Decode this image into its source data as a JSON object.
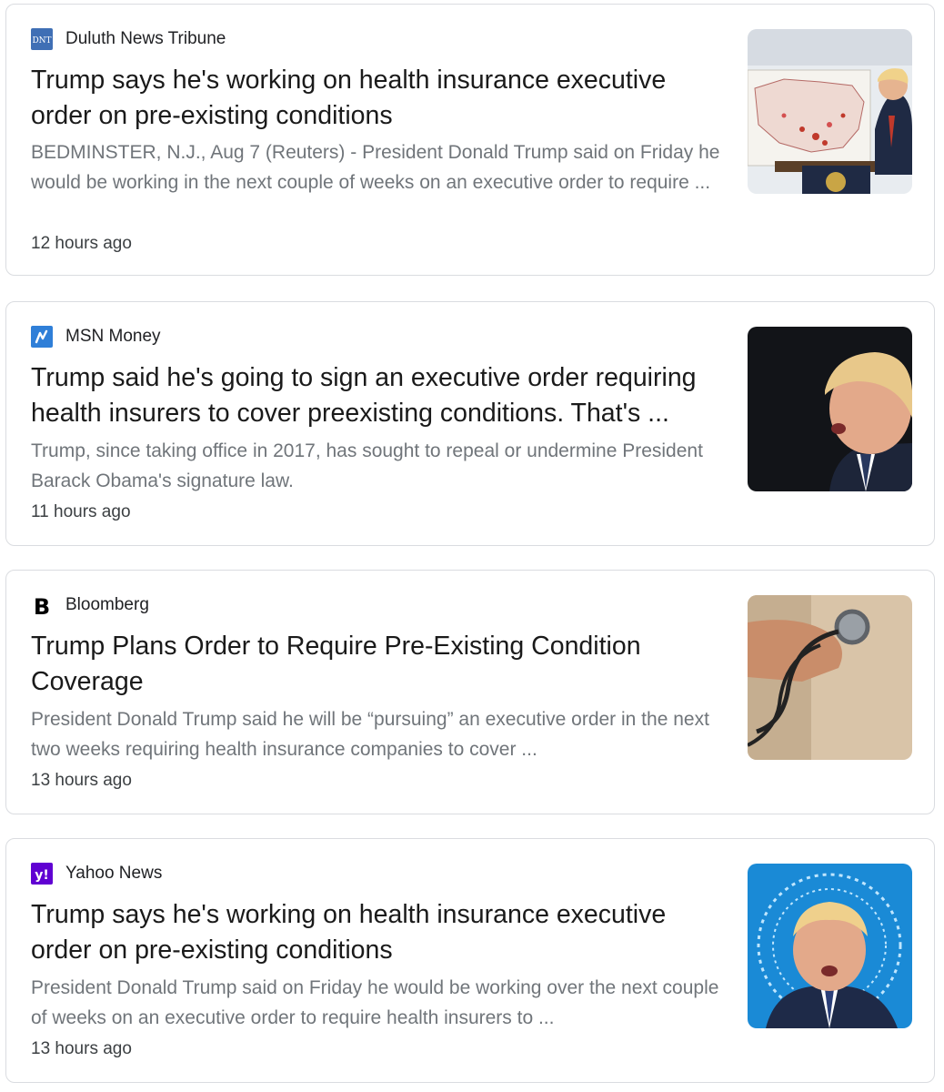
{
  "results": [
    {
      "source": "Duluth News Tribune",
      "favicon_text": "DNT",
      "headline": "Trump says he's working on health insurance executive order on pre-existing conditions",
      "snippet": "BEDMINSTER, N.J., Aug 7 (Reuters) - President Donald Trump said on Friday he would be working in the next couple of weeks on an executive order to require ...",
      "time": "12 hours ago"
    },
    {
      "source": "MSN Money",
      "headline": "Trump said he's going to sign an executive order requiring health insurers to cover preexisting conditions. That's ...",
      "snippet": "Trump, since taking office in 2017, has sought to repeal or undermine President Barack Obama's signature law.",
      "time": "11 hours ago"
    },
    {
      "source": "Bloomberg",
      "favicon_text": "B",
      "headline": "Trump Plans Order to Require Pre-Existing Condition Coverage",
      "snippet": "President Donald Trump said he will be “pursuing” an executive order in the next two weeks requiring health insurance companies to cover ...",
      "time": "13 hours ago"
    },
    {
      "source": "Yahoo News",
      "favicon_text": "y!",
      "headline": "Trump says he's working on health insurance executive order on pre-existing conditions",
      "snippet": "President Donald Trump said on Friday he would be working over the next couple of weeks on an executive order to require health insurers to ...",
      "time": "13 hours ago"
    }
  ],
  "colors": {
    "dnt_blue": "#3f6fb5",
    "msn_blue": "#2f7fd8",
    "bloomberg_black": "#000000",
    "yahoo_purple": "#6001d2"
  }
}
